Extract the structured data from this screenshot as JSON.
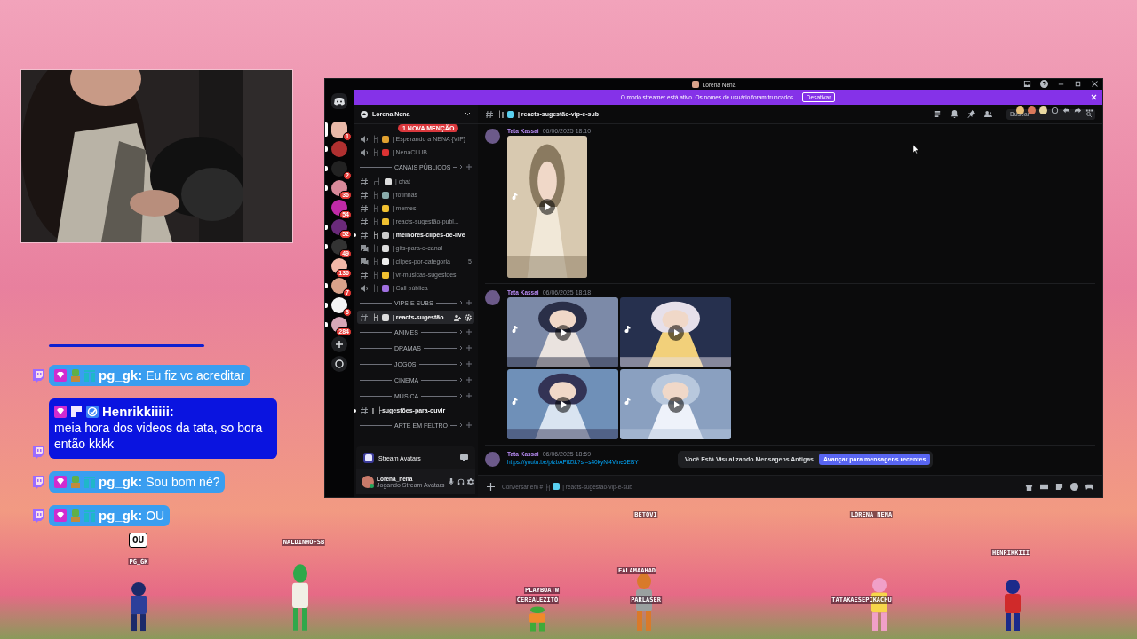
{
  "chat": {
    "messages": [
      {
        "kind": "normal",
        "user": "pg_gk:",
        "text": "Eu fiz vc acreditar"
      },
      {
        "kind": "highlight",
        "user": "Henrikkiiiii:",
        "text": "meia hora dos videos da tata, so bora então kkkk"
      },
      {
        "kind": "normal",
        "user": "pg_gk:",
        "text": "Sou bom né?"
      },
      {
        "kind": "normal",
        "user": "pg_gk:",
        "text": "OU"
      }
    ]
  },
  "avatars": [
    {
      "name": "PG_GK",
      "speech": "OU"
    },
    {
      "name": "NALDINHOFSB"
    },
    {
      "name": "BETOVI"
    },
    {
      "name": "LORENA NENA"
    },
    {
      "name": "HENRIKKIII"
    },
    {
      "name": "FALAMAAHAD"
    },
    {
      "name": "PLAYBOATW"
    },
    {
      "name": "CEREALEZITO"
    },
    {
      "name": "PARLASER"
    },
    {
      "name": "TATAKAESEPIKACHU"
    }
  ],
  "discord": {
    "title": "Lorena Nena",
    "banner": {
      "text": "O modo streamer está ativo. Os nomes de usuário foram truncados.",
      "button": "Desativar"
    },
    "servers": [
      {
        "badge": "1",
        "selected": true
      },
      {
        "selected": false,
        "unread": true
      },
      {
        "badge": "2",
        "selected": false,
        "unread": true
      },
      {
        "badge": "36",
        "selected": false,
        "unread": true
      },
      {
        "badge": "54",
        "selected": false,
        "unread": false
      },
      {
        "badge": "52",
        "selected": false,
        "unread": true
      },
      {
        "badge": "49",
        "selected": false,
        "unread": true
      },
      {
        "badge": "136",
        "selected": false,
        "unread": false
      },
      {
        "badge": "7",
        "selected": false,
        "unread": true
      },
      {
        "badge": "5",
        "selected": false,
        "unread": true
      },
      {
        "badge": "284",
        "selected": false,
        "unread": true
      }
    ],
    "server_name": "Lorena Nena",
    "mention_badge": "1 NOVA MENÇÃO",
    "channels": [
      {
        "kind": "voice",
        "prefix": "├|",
        "name": "| Esperando a NENA {VIP}",
        "selected": false,
        "unread": false
      },
      {
        "kind": "voice",
        "prefix": "├|",
        "name": "| NenaCLUB",
        "selected": false,
        "unread": false
      },
      {
        "kind": "category",
        "name": "CANAIS PÚBLICOS"
      },
      {
        "kind": "text",
        "prefix": "┌┤",
        "name": "| chat",
        "selected": false,
        "unread": false
      },
      {
        "kind": "text",
        "prefix": "├|",
        "name": "| fotinhas",
        "selected": false,
        "unread": false
      },
      {
        "kind": "text",
        "prefix": "├|",
        "name": "| memes",
        "selected": false,
        "unread": false
      },
      {
        "kind": "text",
        "prefix": "├|",
        "name": "| reacts-sugestão-publ...",
        "selected": false,
        "unread": false
      },
      {
        "kind": "text",
        "prefix": "├|",
        "name": "| melhores-clipes-de-live",
        "selected": false,
        "unread": true
      },
      {
        "kind": "forum",
        "prefix": "├|",
        "name": "| gifs-para-o-canal",
        "selected": false,
        "unread": false
      },
      {
        "kind": "forum",
        "prefix": "├|",
        "name": "| clipes-por-categoria",
        "count": "5",
        "selected": false,
        "unread": false
      },
      {
        "kind": "text",
        "prefix": "├|",
        "name": "| vr-musicas-sugestoes",
        "selected": false,
        "unread": false
      },
      {
        "kind": "voice",
        "prefix": "├|",
        "name": "| Call pública",
        "selected": false,
        "unread": false
      },
      {
        "kind": "category",
        "name": "VIPS E SUBS"
      },
      {
        "kind": "text",
        "prefix": "├|",
        "name": "| reacts-sugestão...",
        "selected": true,
        "unread": false
      },
      {
        "kind": "category",
        "name": "ANIMES"
      },
      {
        "kind": "category",
        "name": "DRAMAS"
      },
      {
        "kind": "category",
        "name": "JOGOS"
      },
      {
        "kind": "category",
        "name": "CINEMA"
      },
      {
        "kind": "category",
        "name": "MÚSICA"
      },
      {
        "kind": "text",
        "prefix": "|",
        "name": "├sugestões-para-ouvir",
        "selected": false,
        "unread": true
      },
      {
        "kind": "category",
        "name": "ARTE EM FELTRO"
      }
    ],
    "app_panel": "Stream Avatars",
    "user": {
      "name": "Lorena_nena",
      "status": "Jogando Stream Avatars"
    },
    "channel_header": {
      "prefix": "├|",
      "name": "| reacts-sugestão-vip-e-sub",
      "search_placeholder": "Buscar"
    },
    "messages": [
      {
        "author": "Tata Kassai",
        "time": "06/06/2025 18:10",
        "media": [
          {
            "kind": "video"
          }
        ]
      },
      {
        "author": "Tata Kassai",
        "time": "06/06/2025 18:18",
        "media": [
          {
            "kind": "video"
          },
          {
            "kind": "video"
          },
          {
            "kind": "video"
          },
          {
            "kind": "video"
          }
        ]
      },
      {
        "author": "Tata Kassai",
        "time": "06/06/2025 18:59",
        "link": "https://youtu.be/pizbAPflZtk?si=s40kyNl4Vlne6EBY"
      }
    ],
    "jump_bar": {
      "text": "Você Está Visualizando Mensagens Antigas",
      "button": "Avançar para mensagens recentes"
    },
    "composer": {
      "prefix": "Conversar em # ├|",
      "name": "| reacts-sugestão-vip-e-sub"
    }
  }
}
